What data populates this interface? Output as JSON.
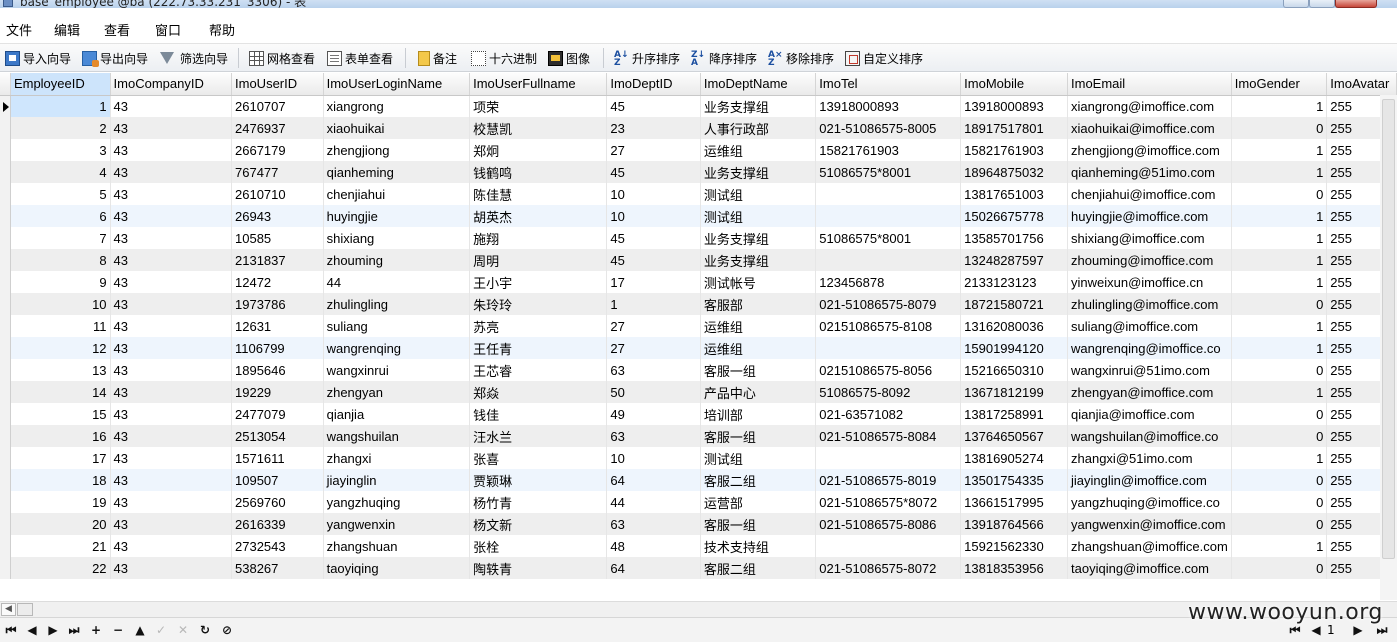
{
  "window": {
    "title": "base_employee @ba (222.73.33.231_3306) - 表"
  },
  "menu": [
    {
      "label": "文件"
    },
    {
      "label": "编辑"
    },
    {
      "label": "查看"
    },
    {
      "label": "窗口"
    },
    {
      "label": "帮助"
    }
  ],
  "toolbar": {
    "import_wizard": "导入向导",
    "export_wizard": "导出向导",
    "filter_wizard": "筛选向导",
    "grid_view": "网格查看",
    "form_view": "表单查看",
    "memo": "备注",
    "hex": "十六进制",
    "image": "图像",
    "sort_asc": "升序排序",
    "sort_desc": "降序排序",
    "remove_sort": "移除排序",
    "custom_sort": "自定义排序"
  },
  "columns": [
    "EmployeeID",
    "ImoCompanyID",
    "ImoUserID",
    "ImoUserLoginName",
    "ImoUserFullname",
    "ImoDeptID",
    "ImoDeptName",
    "ImoTel",
    "ImoMobile",
    "ImoEmail",
    "ImoGender",
    "ImoAvatar"
  ],
  "rows": [
    [
      "1",
      "43",
      "2610707",
      "xiangrong",
      "项荣",
      "45",
      "业务支撑组",
      "13918000893",
      "13918000893",
      "xiangrong@imoffice.com",
      "1",
      "255"
    ],
    [
      "2",
      "43",
      "2476937",
      "xiaohuikai",
      "校慧凯",
      "23",
      "人事行政部",
      "021-51086575-8005",
      "18917517801",
      "xiaohuikai@imoffice.com",
      "0",
      "255"
    ],
    [
      "3",
      "43",
      "2667179",
      "zhengjiong",
      "郑炯",
      "27",
      "运维组",
      "15821761903",
      "15821761903",
      "zhengjiong@imoffice.com",
      "1",
      "255"
    ],
    [
      "4",
      "43",
      "767477",
      "qianheming",
      "钱鹤鸣",
      "45",
      "业务支撑组",
      "51086575*8001",
      "18964875032",
      "qianheming@51imo.com",
      "1",
      "255"
    ],
    [
      "5",
      "43",
      "2610710",
      "chenjiahui",
      "陈佳慧",
      "10",
      "测试组",
      "",
      "13817651003",
      "chenjiahui@imoffice.com",
      "0",
      "255"
    ],
    [
      "6",
      "43",
      "26943",
      "huyingjie",
      "胡英杰",
      "10",
      "测试组",
      "",
      "15026675778",
      "huyingjie@imoffice.com",
      "1",
      "255"
    ],
    [
      "7",
      "43",
      "10585",
      "shixiang",
      "施翔",
      "45",
      "业务支撑组",
      "51086575*8001",
      "13585701756",
      "shixiang@imoffice.com",
      "1",
      "255"
    ],
    [
      "8",
      "43",
      "2131837",
      "zhouming",
      "周明",
      "45",
      "业务支撑组",
      "",
      "13248287597",
      "zhouming@imoffice.com",
      "1",
      "255"
    ],
    [
      "9",
      "43",
      "12472",
      "44",
      "王小宇",
      "17",
      "测试帐号",
      "123456878",
      "2133123123",
      "yinweixun@imoffice.cn",
      "1",
      "255"
    ],
    [
      "10",
      "43",
      "1973786",
      "zhulingling",
      "朱玲玲",
      "1",
      "客服部",
      "021-51086575-8079",
      "18721580721",
      "zhulingling@imoffice.com",
      "0",
      "255"
    ],
    [
      "11",
      "43",
      "12631",
      "suliang",
      "苏亮",
      "27",
      "运维组",
      "02151086575-8108",
      "13162080036",
      "suliang@imoffice.com",
      "1",
      "255"
    ],
    [
      "12",
      "43",
      "1106799",
      "wangrenqing",
      "王任青",
      "27",
      "运维组",
      "",
      "15901994120",
      "wangrenqing@imoffice.co",
      "1",
      "255"
    ],
    [
      "13",
      "43",
      "1895646",
      "wangxinrui",
      "王芯睿",
      "63",
      "客服一组",
      "02151086575-8056",
      "15216650310",
      "wangxinrui@51imo.com",
      "0",
      "255"
    ],
    [
      "14",
      "43",
      "19229",
      "zhengyan",
      "郑焱",
      "50",
      "产品中心",
      "51086575-8092",
      "13671812199",
      "zhengyan@imoffice.com",
      "1",
      "255"
    ],
    [
      "15",
      "43",
      "2477079",
      "qianjia",
      "钱佳",
      "49",
      "培训部",
      "021-63571082",
      "13817258991",
      "qianjia@imoffice.com",
      "0",
      "255"
    ],
    [
      "16",
      "43",
      "2513054",
      "wangshuilan",
      "汪水兰",
      "63",
      "客服一组",
      "021-51086575-8084",
      "13764650567",
      "wangshuilan@imoffice.co",
      "0",
      "255"
    ],
    [
      "17",
      "43",
      "1571611",
      "zhangxi",
      "张喜",
      "10",
      "测试组",
      "",
      "13816905274",
      "zhangxi@51imo.com",
      "1",
      "255"
    ],
    [
      "18",
      "43",
      "109507",
      "jiayinglin",
      "贾颖琳",
      "64",
      "客服二组",
      "021-51086575-8019",
      "13501754335",
      "jiayinglin@imoffice.com",
      "0",
      "255"
    ],
    [
      "19",
      "43",
      "2569760",
      "yangzhuqing",
      "杨竹青",
      "44",
      "运营部",
      "021-51086575*8072",
      "13661517995",
      "yangzhuqing@imoffice.co",
      "0",
      "255"
    ],
    [
      "20",
      "43",
      "2616339",
      "yangwenxin",
      "杨文新",
      "63",
      "客服一组",
      "021-51086575-8086",
      "13918764566",
      "yangwenxin@imoffice.com",
      "0",
      "255"
    ],
    [
      "21",
      "43",
      "2732543",
      "zhangshuan",
      "张栓",
      "48",
      "技术支持组",
      "",
      "15921562330",
      "zhangshuan@imoffice.com",
      "1",
      "255"
    ],
    [
      "22",
      "43",
      "538267",
      "taoyiqing",
      "陶轶青",
      "64",
      "客服二组",
      "021-51086575-8072",
      "13818353956",
      "taoyiqing@imoffice.com",
      "0",
      "255"
    ]
  ],
  "navigator": {
    "page": "1"
  },
  "watermark": "www.wooyun.org"
}
